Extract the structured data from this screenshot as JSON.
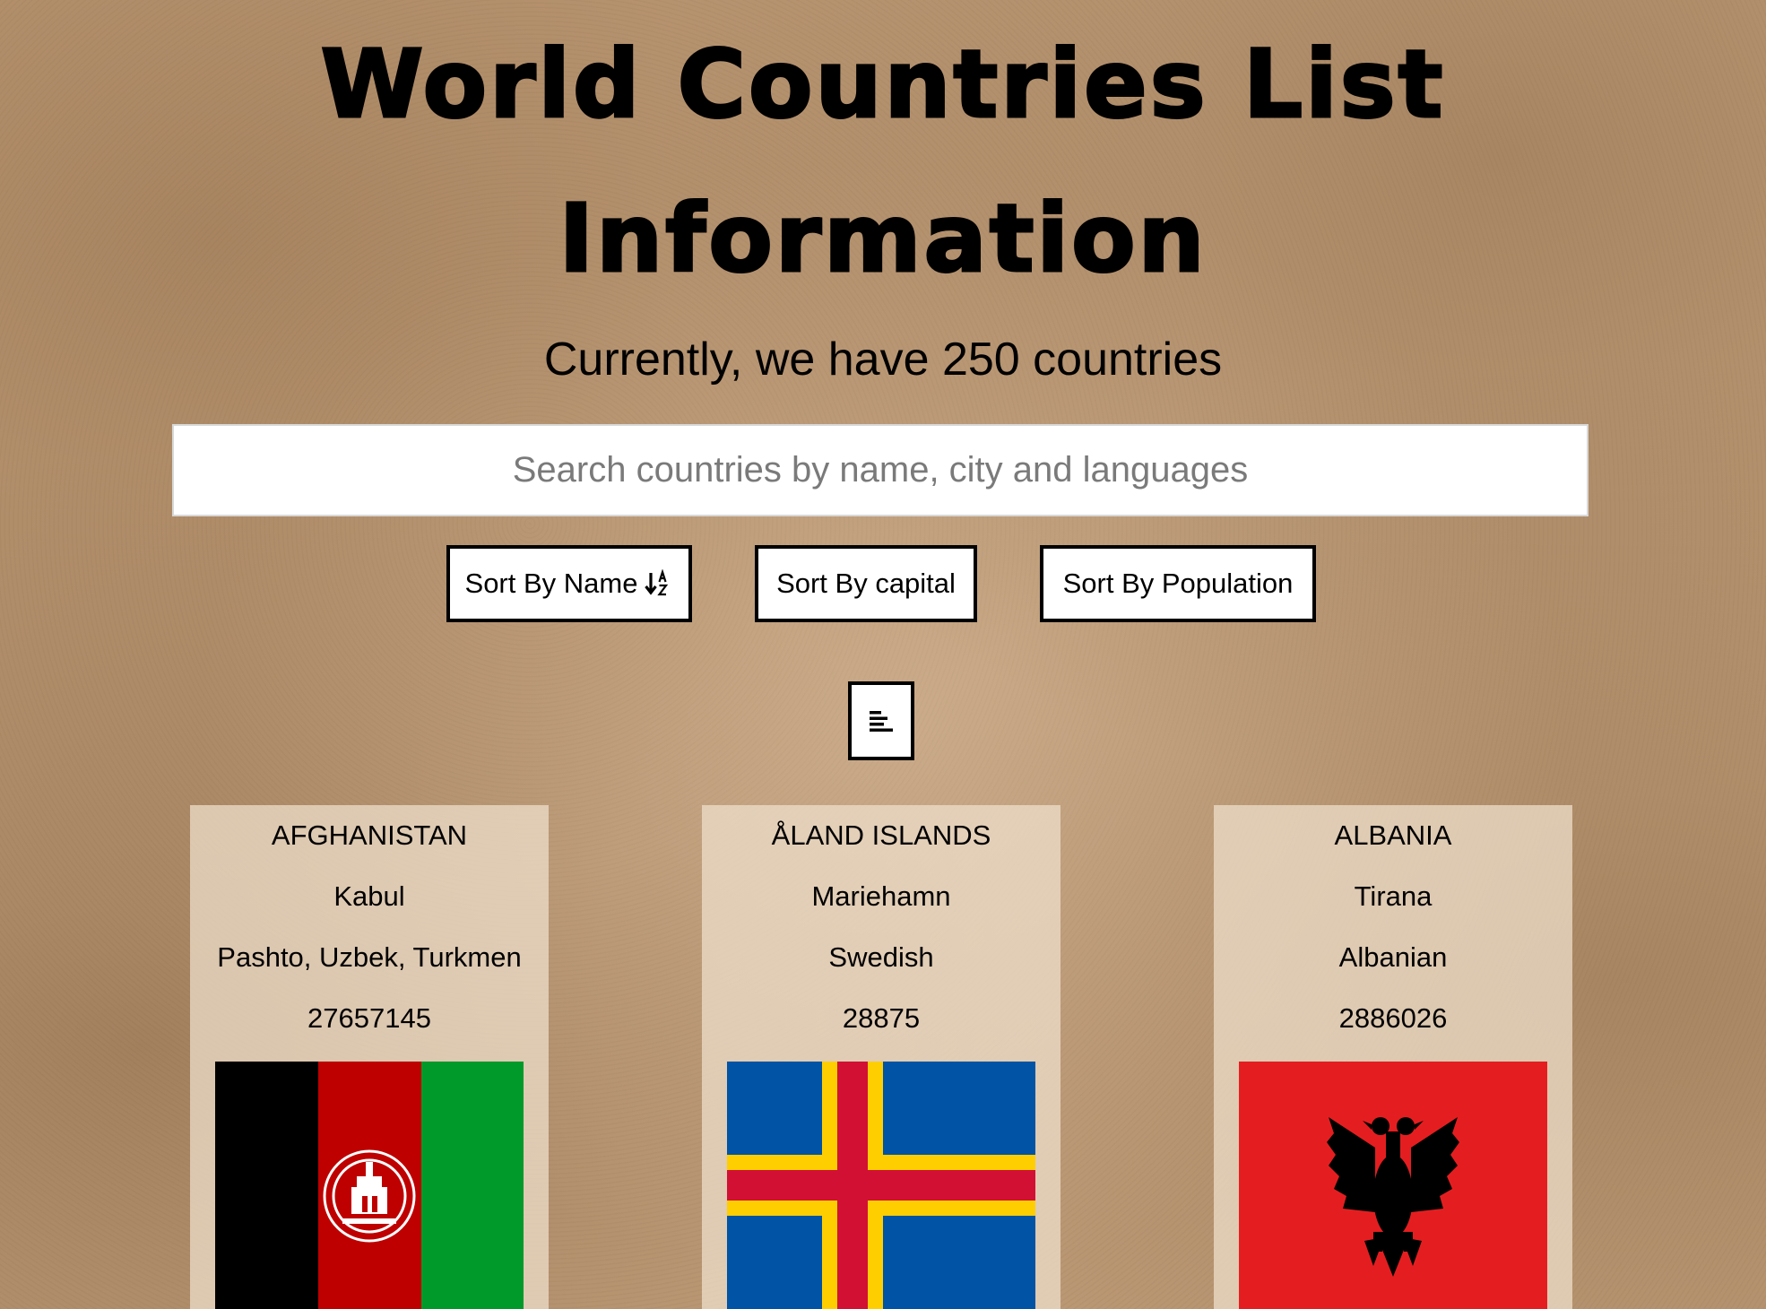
{
  "header": {
    "title_line1": "World Countries List",
    "title_line2": "Information",
    "subtitle": "Currently, we have 250 countries"
  },
  "search": {
    "placeholder": "Search countries by name, city and languages",
    "value": ""
  },
  "sort_buttons": {
    "name_label": "Sort By Name",
    "name_icon": "sort-alpha-down-icon",
    "capital_label": "Sort By capital",
    "population_label": "Sort By Population"
  },
  "view_toggle": {
    "icon": "align-left-lines-icon"
  },
  "countries": [
    {
      "name": "AFGHANISTAN",
      "capital": "Kabul",
      "languages": "Pashto, Uzbek, Turkmen",
      "population": "27657145",
      "flag": "afghanistan-flag",
      "flag_colors": [
        "#000000",
        "#be0000",
        "#009a2a"
      ]
    },
    {
      "name": "ÅLAND ISLANDS",
      "capital": "Mariehamn",
      "languages": "Swedish",
      "population": "28875",
      "flag": "aland-islands-flag",
      "flag_colors": [
        "#0053a5",
        "#ffce00",
        "#d21034"
      ]
    },
    {
      "name": "ALBANIA",
      "capital": "Tirana",
      "languages": "Albanian",
      "population": "2886026",
      "flag": "albania-flag",
      "flag_colors": [
        "#e41e20",
        "#000000"
      ]
    }
  ]
}
